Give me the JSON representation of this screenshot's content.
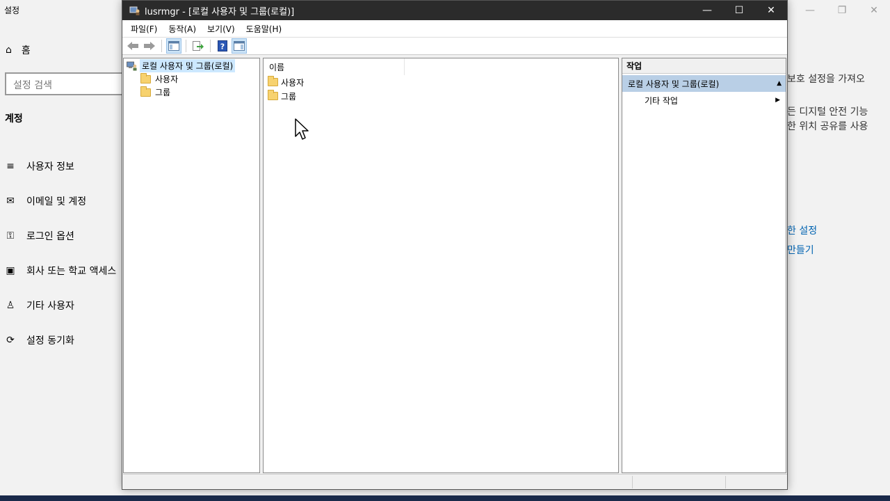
{
  "settings": {
    "title": "설정",
    "home": "홈",
    "search_placeholder": "설정 검색",
    "section": "계정",
    "nav": [
      {
        "label": "사용자 정보",
        "icon": "user-info-icon",
        "glyph": "≡"
      },
      {
        "label": "이메일 및 계정",
        "icon": "mail-icon",
        "glyph": "✉"
      },
      {
        "label": "로그인 옵션",
        "icon": "key-icon",
        "glyph": "⚿"
      },
      {
        "label": "회사 또는 학교 액세스",
        "icon": "briefcase-icon",
        "glyph": "▣"
      },
      {
        "label": "기타 사용자",
        "icon": "person-icon",
        "glyph": "♙"
      },
      {
        "label": "설정 동기화",
        "icon": "sync-icon",
        "glyph": "⟳"
      }
    ],
    "right_text": [
      "보호 설정을 가져오",
      "든 디지털 안전 기능",
      "한 위치 공유를 사용"
    ],
    "right_links": [
      "한 설정",
      "만들기"
    ]
  },
  "mmc": {
    "title": "lusrmgr - [로컬 사용자 및 그룹(로컬)]",
    "menu": [
      "파일(F)",
      "동작(A)",
      "보기(V)",
      "도움말(H)"
    ],
    "tree": {
      "root": "로컬 사용자 및 그룹(로컬)",
      "children": [
        "사용자",
        "그룹"
      ]
    },
    "list": {
      "column": "이름",
      "items": [
        "사용자",
        "그룹"
      ]
    },
    "actions": {
      "header": "작업",
      "section": "로컬 사용자 및 그룹(로컬)",
      "more": "기타 작업"
    }
  },
  "colors": {
    "titlebar": "#2b2b2b",
    "selection": "#cce8ff",
    "action_section": "#b9cfe6",
    "link": "#0063b1"
  }
}
